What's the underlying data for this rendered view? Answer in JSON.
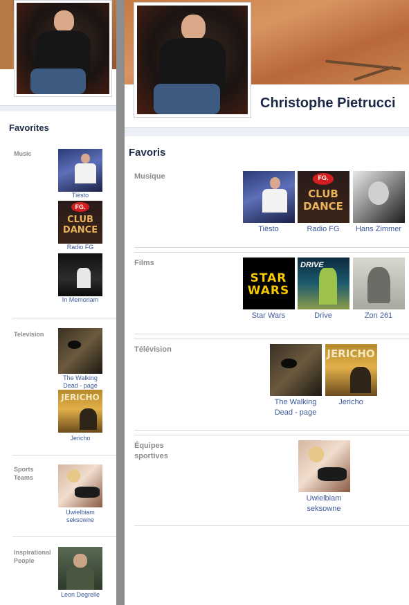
{
  "profile": {
    "name": "Christophe Pietrucci"
  },
  "left_panel": {
    "title": "Favorites",
    "sections": [
      {
        "label": "Music",
        "items": [
          "Tiësto",
          "Radio FG",
          "In Memoriam"
        ]
      },
      {
        "label": "Television",
        "items": [
          "The Walking Dead - page",
          "Jericho"
        ]
      },
      {
        "label": "Sports Teams",
        "items": [
          "Uwielbiam seksowne"
        ]
      },
      {
        "label": "Inspirational People",
        "items": [
          "Leon Degrelle"
        ]
      }
    ]
  },
  "main_panel": {
    "title": "Favoris",
    "sections": [
      {
        "label": "Musique",
        "items": [
          "Tiësto",
          "Radio FG",
          "Hans Zimmer"
        ]
      },
      {
        "label": "Films",
        "items": [
          "Star Wars",
          "Drive",
          "Zon 261"
        ]
      },
      {
        "label": "Télévision",
        "items": [
          "The Walking Dead - page",
          "Jericho"
        ]
      },
      {
        "label": "Équipes sportives",
        "items": [
          "Uwielbiam seksowne"
        ]
      }
    ]
  },
  "thumb_text": {
    "fg_badge": "FG.",
    "club": "CLUB",
    "dance": "DANCE",
    "star": "STAR",
    "wars": "WARS",
    "drive": "DRIVE",
    "jericho": "JERICHO"
  },
  "colors": {
    "link": "#3b5998",
    "heading": "#1c2a47",
    "label": "#8c8c8c"
  }
}
